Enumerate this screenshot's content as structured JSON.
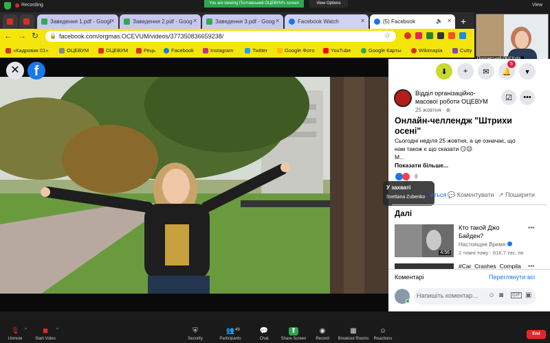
{
  "zoom_top": {
    "recording": "Recording",
    "viewing_banner": "You are viewing Полтавський ОЦЕВУМ's screen",
    "view_options": "View Options",
    "view": "View"
  },
  "tabs": [
    {
      "label": "Заведення 1.pdf - Googl",
      "color": "#1a73e8"
    },
    {
      "label": "Заведення 2.pdf - Goog",
      "color": "#1a73e8"
    },
    {
      "label": "Заведення 3.pdf - Goog",
      "color": "#1a73e8"
    },
    {
      "label": "Facebook Watch",
      "color": "#1877f2"
    },
    {
      "label": "(5) Facebook",
      "color": "#1877f2"
    }
  ],
  "address": {
    "url": "facebook.com/orgmas.OCEVUM/videos/377350836659238/"
  },
  "bookmarks": [
    {
      "label": "«Кадровик 01»",
      "color": "#d93025"
    },
    {
      "label": "ОЦЕВУМ",
      "color": "#888"
    },
    {
      "label": "ОЦЕВУМ",
      "color": "#d93025"
    },
    {
      "label": "Рець",
      "color": "#d93025"
    },
    {
      "label": "Facebook",
      "color": "#1877f2"
    },
    {
      "label": "Instagram",
      "color": "#c13584"
    },
    {
      "label": "Twitter",
      "color": "#1da1f2"
    },
    {
      "label": "Google Фото",
      "color": "#fbbc05"
    },
    {
      "label": "YouTube",
      "color": "#ff0000"
    },
    {
      "label": "Google Карты",
      "color": "#34a853"
    },
    {
      "label": "Wikimapia",
      "color": "#d93025"
    },
    {
      "label": "Cutty",
      "color": "#8e44ad"
    }
  ],
  "participant": {
    "name": "Полтавський ОЦЕВУМ"
  },
  "post": {
    "page_name_line1": "Відділ організаційно-",
    "page_name_line2": "масової роботи ОЦЕВУМ",
    "date": "25 жовтня · ⊕",
    "title_line1": "Онлайн-челлендж \"Штрихи",
    "title_line2": "осені\"",
    "body_line1": "Сьогодні неділя 25 жовтня, а це означає, що",
    "body_line2": "нам також є що сказати 😏😉",
    "body_line3": "М...",
    "show_more": "Показати більше...",
    "reaction_count": "8",
    "tooltip_title": "У захваті",
    "tooltip_name": "Svetlana Zubenko",
    "share_frag": "иться",
    "comment_action": "Коментувати",
    "share_action": "Поширити"
  },
  "next": {
    "heading": "Далі",
    "video1_title_line1": "Кто такой Джо",
    "video1_title_line2": "Байден?",
    "video1_channel": "Настоящее Время",
    "video1_meta": "2 тижні тому · 616,7 тис. пе",
    "video1_duration": "4:56",
    "video2_title": "#Car_Crashes_Compila"
  },
  "comments": {
    "label": "Коментарі",
    "view_all": "Переглянути всі",
    "placeholder": "Напишіть коментар..."
  },
  "notifications": {
    "badge": "5"
  },
  "zoom_bottom": {
    "unmute": "Unmute",
    "start_video": "Start Video",
    "security": "Security",
    "participants": "Participants",
    "participants_count": "49",
    "chat": "Chat",
    "share_screen": "Share Screen",
    "record": "Record",
    "breakout": "Breakout Rooms",
    "reactions": "Reactions",
    "end": "End"
  }
}
